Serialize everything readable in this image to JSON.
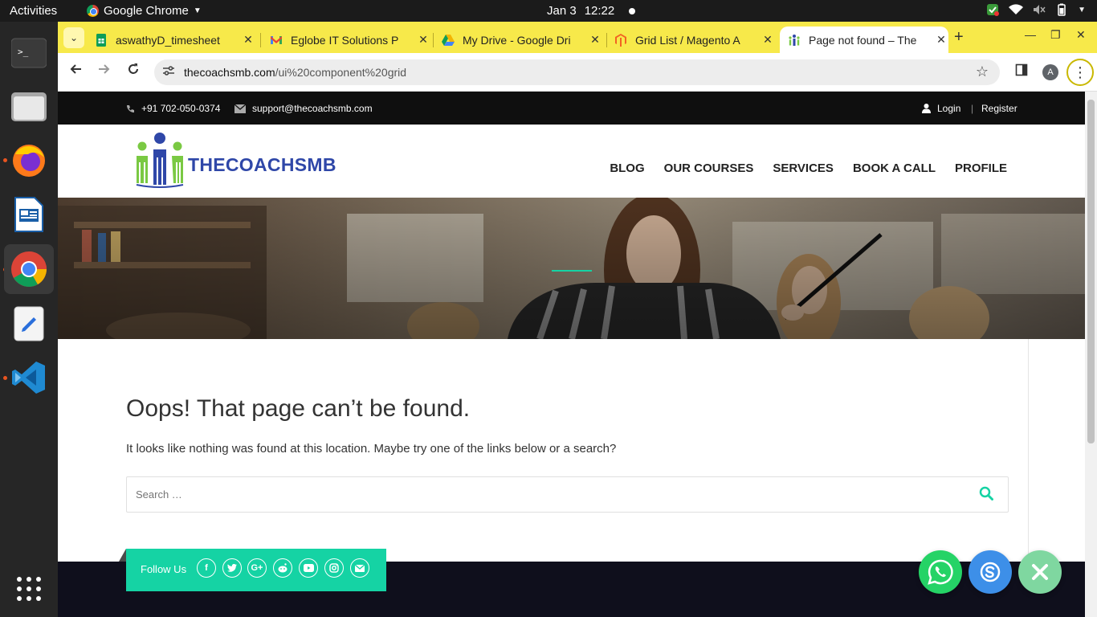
{
  "os_topbar": {
    "activities": "Activities",
    "app_name": "Google Chrome",
    "date": "Jan 3",
    "time": "12:22"
  },
  "dock": {
    "items": [
      "terminal-icon",
      "files-icon",
      "firefox-icon",
      "libreoffice-impress-icon",
      "chrome-icon",
      "text-editor-icon",
      "vscode-icon",
      "app-grid-icon"
    ]
  },
  "browser": {
    "tabs": [
      {
        "title": "aswathyD_timesheet",
        "icon": "google-sheets-icon"
      },
      {
        "title": "Eglobe IT Solutions P",
        "icon": "gmail-icon"
      },
      {
        "title": "My Drive - Google Dri",
        "icon": "google-drive-icon"
      },
      {
        "title": "Grid List / Magento A",
        "icon": "magento-icon"
      },
      {
        "title": "Page not found – The",
        "icon": "thecoachsmb-favicon",
        "active": true
      }
    ],
    "url_host": "thecoachsmb.com",
    "url_path": "/ui%20component%20grid",
    "profile_initial": "A"
  },
  "site": {
    "phone": "+91 702-050-0374",
    "email": "support@thecoachsmb.com",
    "login": "Login",
    "register": "Register",
    "logo_text": "THECOACHSMB",
    "nav": [
      "BLOG",
      "OUR COURSES",
      "SERVICES",
      "BOOK A CALL",
      "PROFILE"
    ],
    "heading": "Oops! That page can’t be found.",
    "message": "It looks like nothing was found at this location. Maybe try one of the links below or a search?",
    "search_placeholder": "Search …",
    "follow_label": "Follow Us",
    "social": [
      "facebook-icon",
      "twitter-icon",
      "google-plus-icon",
      "reddit-icon",
      "youtube-icon",
      "instagram-icon",
      "email-icon"
    ]
  },
  "colors": {
    "accent": "#15d3a4",
    "logo_blue": "#2f47a8",
    "tabstrip": "#f7e94a",
    "whatsapp": "#25d366",
    "skype": "#3d8fe8"
  }
}
